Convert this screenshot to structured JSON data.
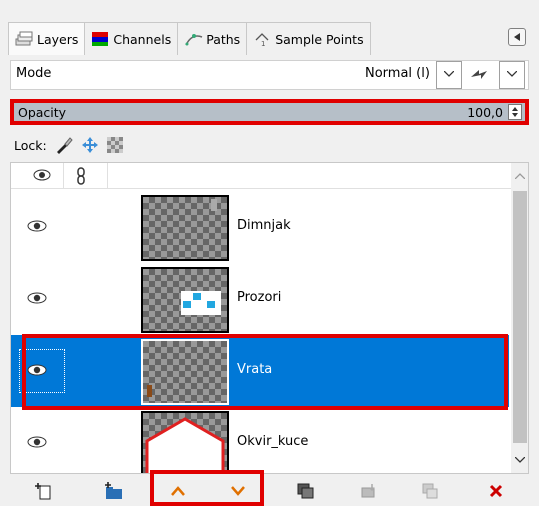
{
  "tabs": [
    {
      "label": "Layers",
      "icon": "layers-icon",
      "active": true
    },
    {
      "label": "Channels",
      "icon": "channels-icon",
      "active": false
    },
    {
      "label": "Paths",
      "icon": "paths-icon",
      "active": false
    },
    {
      "label": "Sample Points",
      "icon": "sample-points-icon",
      "active": false
    }
  ],
  "mode": {
    "label": "Mode",
    "value": "Normal (l)"
  },
  "opacity": {
    "label": "Opacity",
    "value": "100,0"
  },
  "lock": {
    "label": "Lock:"
  },
  "layers": [
    {
      "name": "Dimnjak",
      "selected": false
    },
    {
      "name": "Prozori",
      "selected": false
    },
    {
      "name": "Vrata",
      "selected": true
    },
    {
      "name": "Okvir_kuce",
      "selected": false
    }
  ],
  "colors": {
    "selection": "#0078d7",
    "highlight": "#e00000",
    "accent_orange": "#e07000",
    "delete_red": "#cc0000"
  }
}
